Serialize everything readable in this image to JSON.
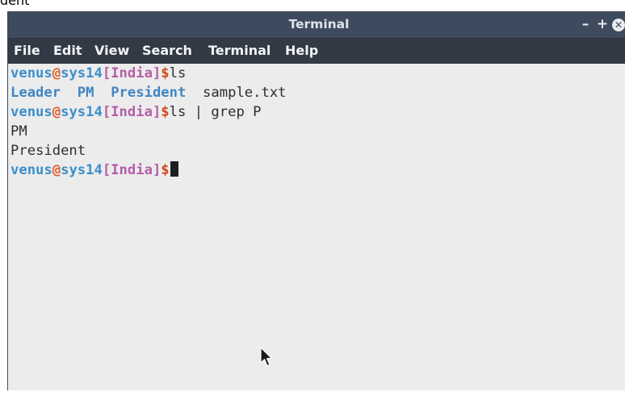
{
  "top_fragment": "dent",
  "window": {
    "title": "Terminal",
    "minimize_label": "–",
    "maximize_label": "+",
    "close_label": "✕"
  },
  "menubar": {
    "items": [
      "File",
      "Edit",
      "View",
      "Search",
      "Terminal",
      "Help"
    ]
  },
  "prompt": {
    "user": "venus",
    "at": "@",
    "host": "sys14",
    "dir": "[India]",
    "dollar": "$"
  },
  "terminal": {
    "cmd1": "ls",
    "ls_output": {
      "dirs": [
        "Leader",
        "PM",
        "President"
      ],
      "files": [
        "sample.txt"
      ]
    },
    "cmd2": "ls | grep P",
    "grep_output": [
      "PM",
      "President"
    ]
  },
  "icons": {
    "mouse": "mouse-pointer-icon",
    "close": "close-icon"
  },
  "colors": {
    "titlebar": "#3e4a5d",
    "menubar": "#323a46",
    "terminal_bg": "#ececec",
    "prompt_user": "#3b8fcb",
    "prompt_at": "#e45d2f",
    "prompt_dir": "#b45ea7",
    "prompt_dollar": "#d54a1c",
    "dir_entry": "#3f86c2"
  }
}
